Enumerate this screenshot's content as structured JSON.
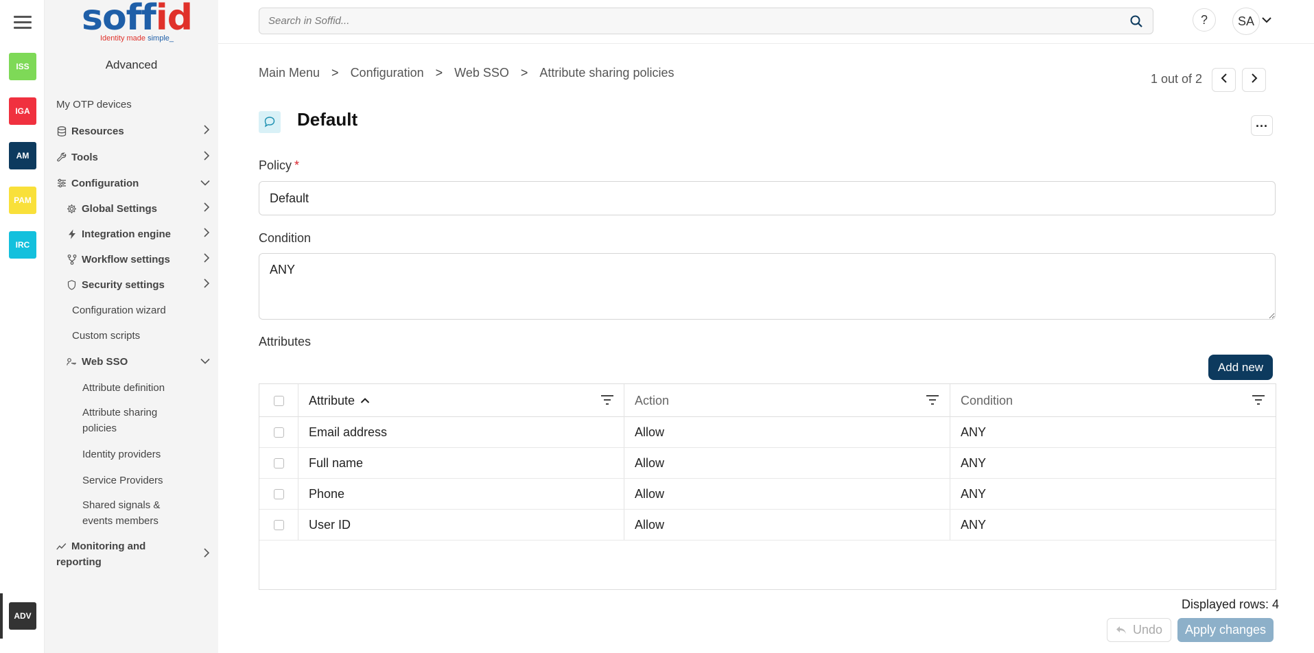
{
  "rail": {
    "apps": [
      {
        "label": "ISS",
        "color": "#7ed957"
      },
      {
        "label": "IGA",
        "color": "#f0313f"
      },
      {
        "label": "AM",
        "color": "#0d3a5e"
      },
      {
        "label": "PAM",
        "color": "#f9e03a"
      },
      {
        "label": "IRC",
        "color": "#13c0dd"
      }
    ],
    "active_app": {
      "label": "ADV",
      "color": "#333333"
    }
  },
  "logo": {
    "word_main": "soff",
    "word_accent": "id",
    "tagline_a": "Identity made ",
    "tagline_b": "simple_"
  },
  "sidebar": {
    "section_title": "Advanced",
    "items": [
      {
        "label": "My OTP devices",
        "icon": "none"
      },
      {
        "label": "Resources",
        "icon": "database-icon",
        "chevron": "right"
      },
      {
        "label": "Tools",
        "icon": "wrench-icon",
        "chevron": "right"
      },
      {
        "label": "Configuration",
        "icon": "sliders-icon",
        "chevron": "down"
      },
      {
        "label": "Global Settings",
        "icon": "gear-icon",
        "chevron": "right"
      },
      {
        "label": "Integration engine",
        "icon": "bolt-icon",
        "chevron": "right"
      },
      {
        "label": "Workflow settings",
        "icon": "workflow-icon",
        "chevron": "right"
      },
      {
        "label": "Security settings",
        "icon": "shield-icon",
        "chevron": "right"
      },
      {
        "label": "Configuration wizard"
      },
      {
        "label": "Custom scripts"
      },
      {
        "label": "Web SSO",
        "icon": "key-user-icon",
        "chevron": "down"
      },
      {
        "label": "Attribute definition"
      },
      {
        "label": "Attribute sharing policies"
      },
      {
        "label": "Identity providers"
      },
      {
        "label": "Service Providers"
      },
      {
        "label": "Shared signals & events members"
      },
      {
        "label": "Monitoring and reporting",
        "icon": "chart-line-icon",
        "chevron": "right"
      }
    ]
  },
  "header": {
    "search_placeholder": "Search in Soffid...",
    "help_label": "?",
    "user_initials": "SA"
  },
  "breadcrumb": [
    "Main Menu",
    "Configuration",
    "Web SSO",
    "Attribute sharing policies"
  ],
  "breadcrumb_sep": ">",
  "pager": {
    "text": "1 out of 2"
  },
  "page": {
    "title": "Default",
    "more_label": "..."
  },
  "form": {
    "policy_label": "Policy",
    "required_mark": "*",
    "policy_value": "Default",
    "condition_label": "Condition",
    "condition_value": "ANY",
    "attributes_label": "Attributes"
  },
  "table": {
    "add_label": "Add new",
    "columns": [
      "Attribute",
      "Action",
      "Condition"
    ],
    "rows": [
      [
        "Email address",
        "Allow",
        "ANY"
      ],
      [
        "Full name",
        "Allow",
        "ANY"
      ],
      [
        "Phone",
        "Allow",
        "ANY"
      ],
      [
        "User ID",
        "Allow",
        "ANY"
      ]
    ],
    "rows_count_text": "Displayed rows: 4"
  },
  "footer": {
    "undo_label": "Undo",
    "apply_label": "Apply changes"
  }
}
